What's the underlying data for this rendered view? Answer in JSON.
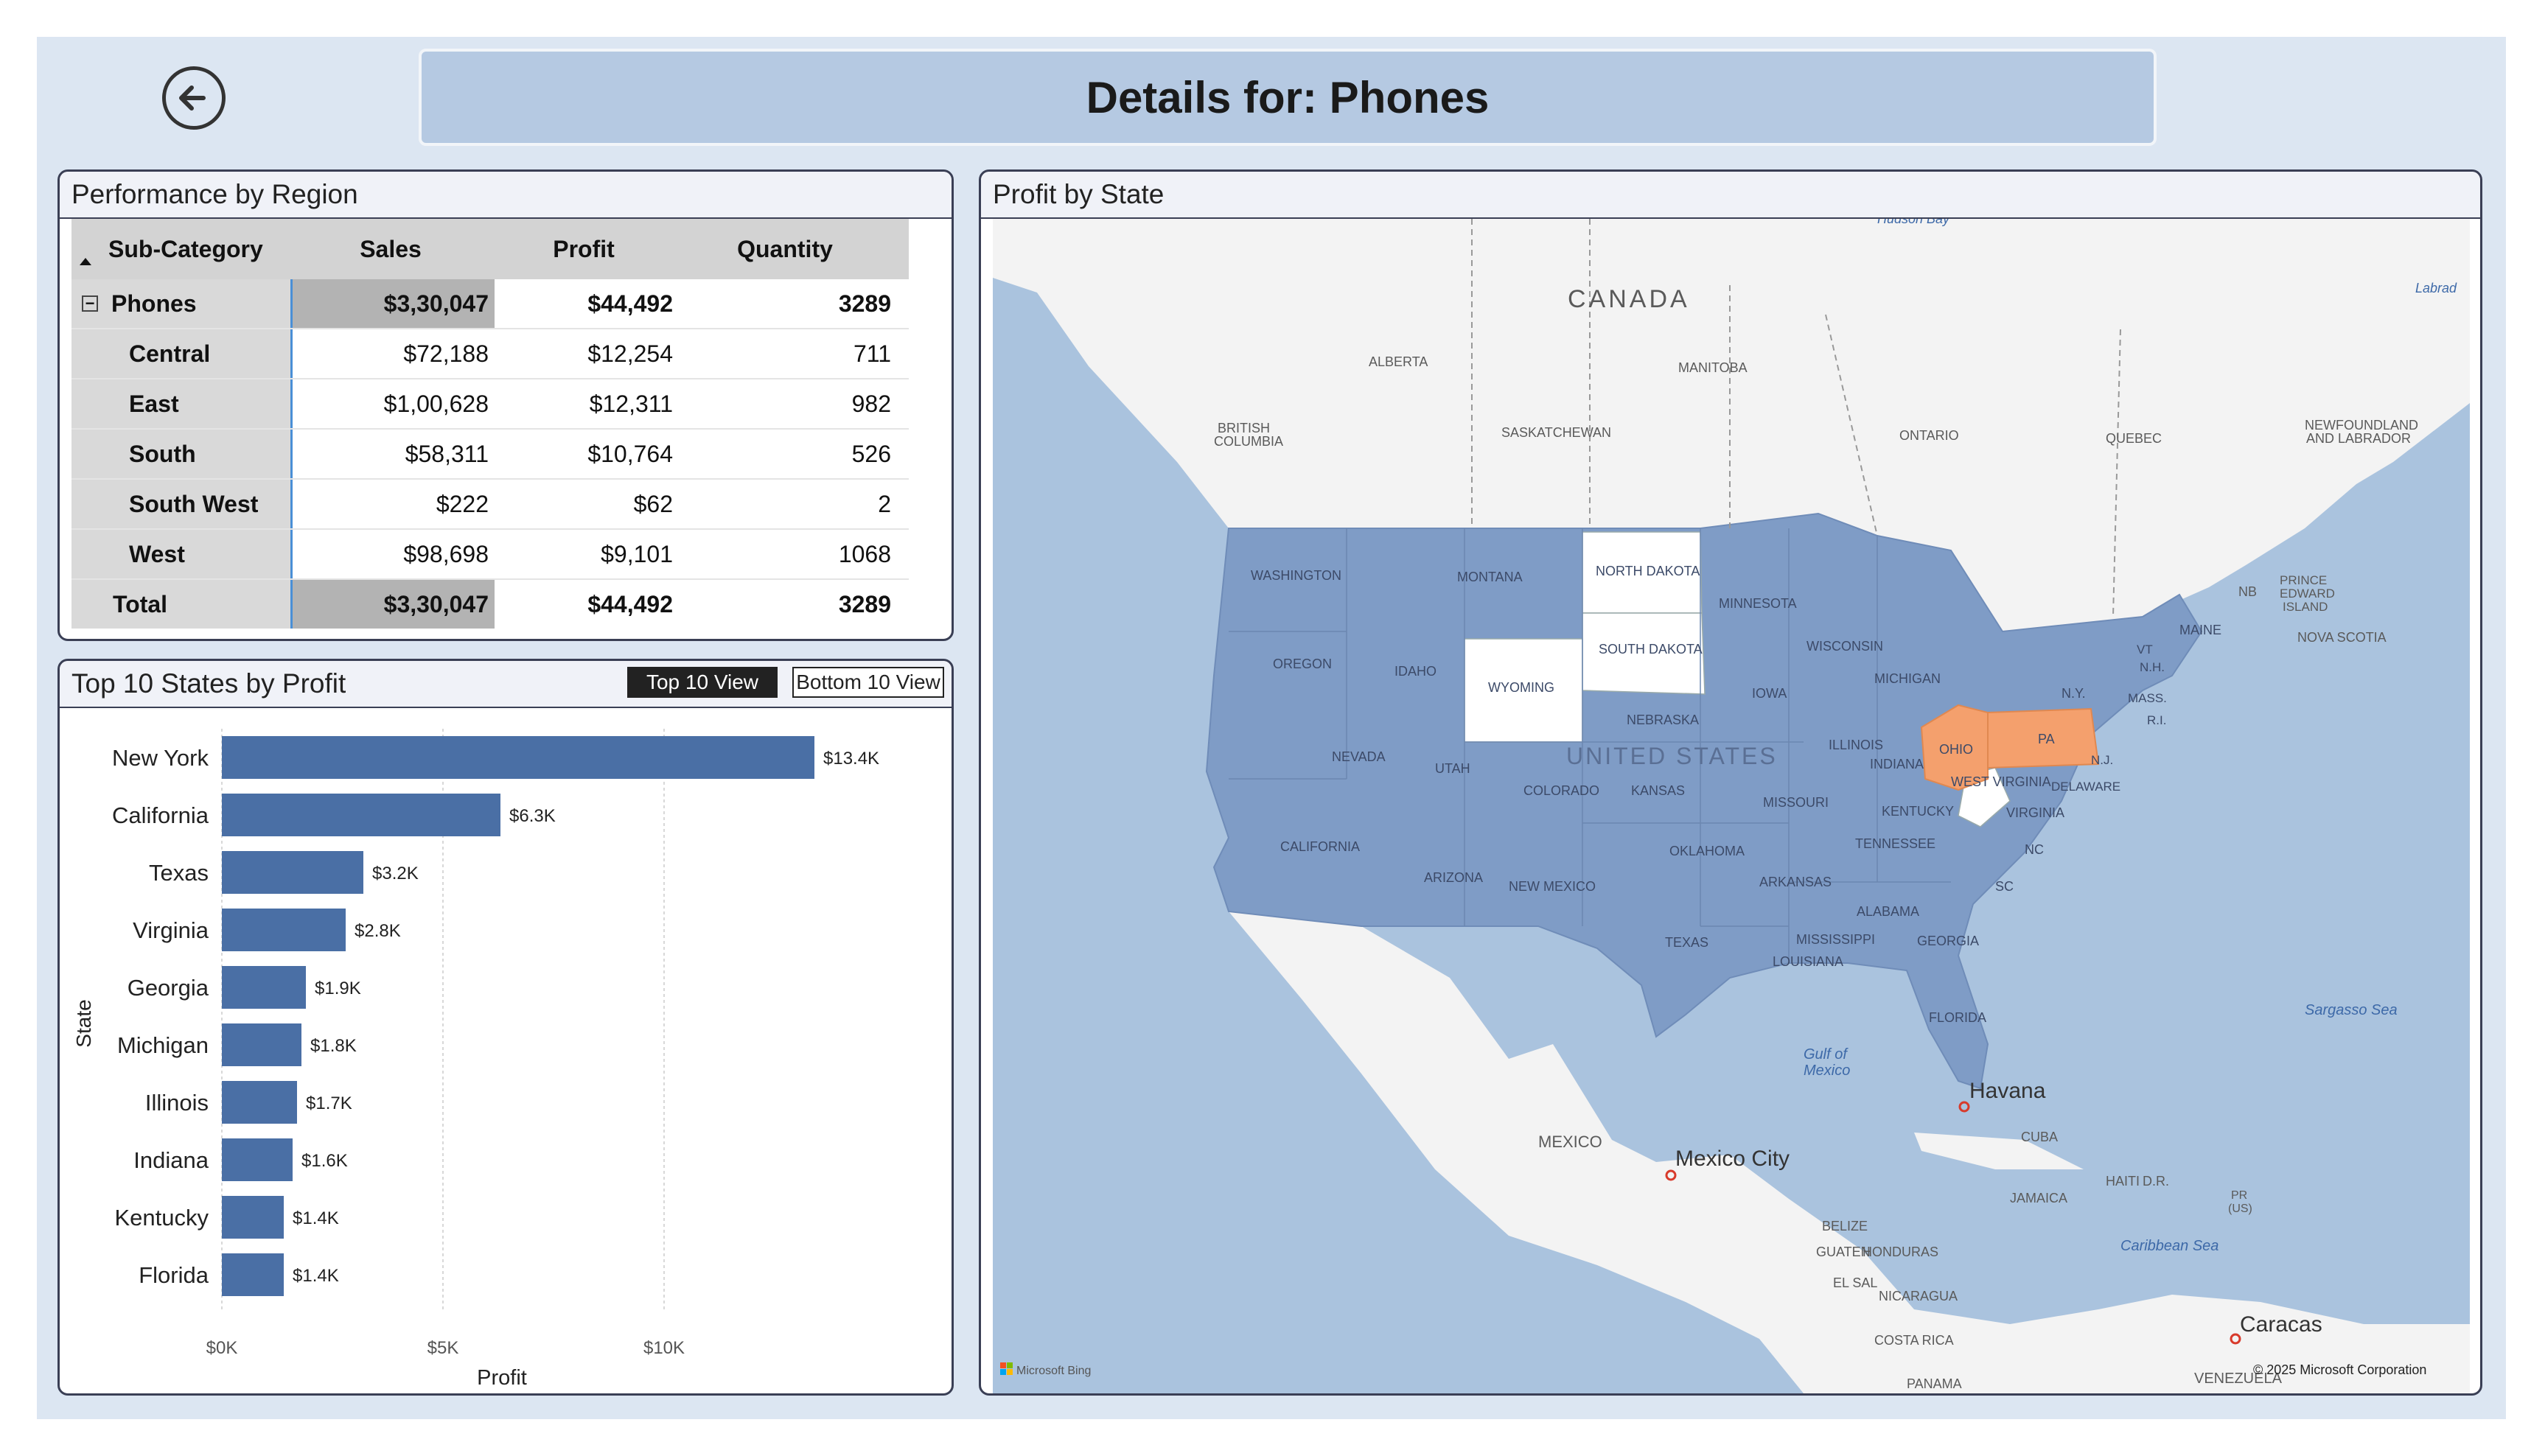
{
  "header": {
    "back_icon": "arrow-left-circle-icon",
    "title": "Details for: Phones"
  },
  "performance": {
    "title": "Performance by Region",
    "columns": [
      "Sub-Category",
      "Sales",
      "Profit",
      "Quantity"
    ],
    "group": {
      "name": "Phones",
      "sales": "$3,30,047",
      "profit": "$44,492",
      "quantity": "3289"
    },
    "rows": [
      {
        "name": "Central",
        "sales": "$72,188",
        "profit": "$12,254",
        "quantity": "711"
      },
      {
        "name": "East",
        "sales": "$1,00,628",
        "profit": "$12,311",
        "quantity": "982"
      },
      {
        "name": "South",
        "sales": "$58,311",
        "profit": "$10,764",
        "quantity": "526"
      },
      {
        "name": "South West",
        "sales": "$222",
        "profit": "$62",
        "quantity": "2"
      },
      {
        "name": "West",
        "sales": "$98,698",
        "profit": "$9,101",
        "quantity": "1068"
      }
    ],
    "total": {
      "name": "Total",
      "sales": "$3,30,047",
      "profit": "$44,492",
      "quantity": "3289"
    }
  },
  "top_states": {
    "title": "Top 10 States by Profit",
    "toggle_top": "Top 10 View",
    "toggle_bottom": "Bottom 10 View"
  },
  "chart_data": {
    "type": "bar",
    "orientation": "horizontal",
    "categories": [
      "New York",
      "California",
      "Texas",
      "Virginia",
      "Georgia",
      "Michigan",
      "Illinois",
      "Indiana",
      "Kentucky",
      "Florida"
    ],
    "values": [
      13400,
      6300,
      3200,
      2800,
      1900,
      1800,
      1700,
      1600,
      1400,
      1400
    ],
    "labels": [
      "$13.4K",
      "$6.3K",
      "$3.2K",
      "$2.8K",
      "$1.9K",
      "$1.8K",
      "$1.7K",
      "$1.6K",
      "$1.4K",
      "$1.4K"
    ],
    "xlabel": "Profit",
    "ylabel": "State",
    "xlim": [
      0,
      15000
    ],
    "xticks": [
      0,
      5000,
      10000
    ],
    "xtick_labels": [
      "$0K",
      "$5K",
      "$10K"
    ],
    "grid": true,
    "bar_color": "#4a6fa5"
  },
  "map": {
    "title": "Profit by State",
    "attribution": "© 2025 Microsoft Corporation",
    "bing": "Microsoft Bing",
    "colors": {
      "water": "#aac3de",
      "land": "#f3f3f3",
      "us_fill": "#7f9cc6",
      "highlight": "#f4a06d",
      "blank_state": "#ffffff"
    },
    "labels": {
      "canada": "CANADA",
      "us": "UNITED STATES",
      "mexico": "MEXICO",
      "hudson": "Hudson Bay",
      "labrador": "Labrad",
      "sargasso": "Sargasso Sea",
      "gulf1": "Gulf of",
      "gulf2": "Mexico",
      "caribbean": "Caribbean Sea",
      "havana": "Havana",
      "mexico_city": "Mexico City",
      "caracas": "Caracas",
      "cuba": "CUBA",
      "jamaica": "JAMAICA",
      "haiti": "HAITI",
      "dr": "D.R.",
      "pr1": "PR",
      "pr2": "(US)",
      "belize": "BELIZE",
      "honduras": "HONDURAS",
      "guatemala": "GUATEN",
      "el_salvador": "EL SAL",
      "nicaragua": "NICARAGUA",
      "costa_rica": "COSTA RICA",
      "panama": "PANAMA",
      "venezuela": "VENEZUELA",
      "alberta": "ALBERTA",
      "bc1": "BRITISH",
      "bc2": "COLUMBIA",
      "saskatchewan": "SASKATCHEWAN",
      "manitoba": "MANITOBA",
      "ontario": "ONTARIO",
      "quebec": "QUEBEC",
      "nl1": "NEWFOUNDLAND",
      "nl2": "AND LABRADOR",
      "nb": "NB",
      "pei1": "PRINCE",
      "pei2": "EDWARD",
      "pei3": "ISLAND",
      "nova_scotia": "NOVA SCOTIA",
      "washington": "WASHINGTON",
      "oregon": "OREGON",
      "california": "CALIFORNIA",
      "nevada": "NEVADA",
      "idaho": "IDAHO",
      "montana": "MONTANA",
      "wyoming": "WYOMING",
      "utah": "UTAH",
      "arizona": "ARIZONA",
      "colorado": "COLORADO",
      "new_mexico": "NEW MEXICO",
      "north_dakota": "NORTH DAKOTA",
      "south_dakota": "SOUTH DAKOTA",
      "nebraska": "NEBRASKA",
      "kansas": "KANSAS",
      "oklahoma": "OKLAHOMA",
      "texas": "TEXAS",
      "minnesota": "MINNESOTA",
      "iowa": "IOWA",
      "missouri": "MISSOURI",
      "arkansas": "ARKANSAS",
      "louisiana": "LOUISIANA",
      "wisconsin": "WISCONSIN",
      "illinois": "ILLINOIS",
      "michigan": "MICHIGAN",
      "indiana": "INDIANA",
      "ohio": "OHIO",
      "kentucky": "KENTUCKY",
      "tennessee": "TENNESSEE",
      "mississippi": "MISSISSIPPI",
      "alabama": "ALABAMA",
      "georgia": "GEORGIA",
      "florida": "FLORIDA",
      "sc": "SC",
      "nc": "NC",
      "virginia": "VIRGINIA",
      "west_virginia": "WEST VIRGINIA",
      "pa": "PA",
      "ny": "N.Y.",
      "maine": "MAINE",
      "vt": "VT",
      "nh": "N.H.",
      "mass": "MASS.",
      "ri": "R.I.",
      "nj": "N.J.",
      "delaware": "DELAWARE"
    }
  }
}
